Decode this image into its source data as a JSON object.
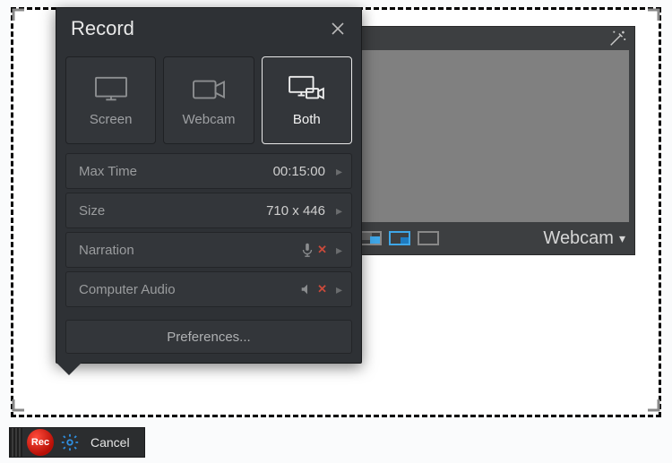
{
  "popover": {
    "title": "Record",
    "sources": {
      "screen": "Screen",
      "webcam": "Webcam",
      "both": "Both",
      "selected": "both"
    },
    "settings": {
      "maxTime": {
        "label": "Max Time",
        "value": "00:15:00"
      },
      "size": {
        "label": "Size",
        "value": "710 x 446"
      },
      "narration": {
        "label": "Narration",
        "status": "off"
      },
      "computerAudio": {
        "label": "Computer Audio",
        "status": "off"
      }
    },
    "preferences": "Preferences..."
  },
  "webcamPanel": {
    "label": "Webcam"
  },
  "toolbar": {
    "rec": "Rec",
    "cancel": "Cancel"
  }
}
